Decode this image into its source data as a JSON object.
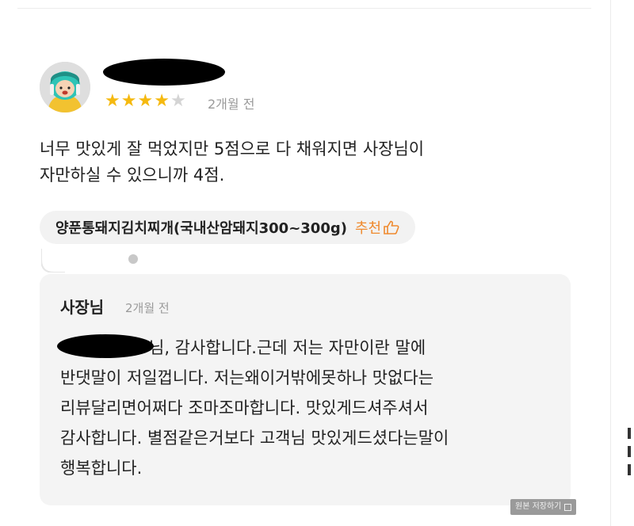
{
  "review": {
    "rating": 4,
    "max_rating": 5,
    "stars": "★★★★★",
    "time": "2개월 전",
    "text_lines": [
      "너무 맛있게 잘 먹었지만 5점으로 다 채워지면 사장님이",
      "자만하실 수 있으니까 4점."
    ],
    "menu_tag": "양푼통돼지김치찌개(국내산암돼지300~300g)",
    "recommend_label": "추천"
  },
  "reply": {
    "author": "사장님",
    "time": "2개월 전",
    "lines": [
      "님, 감사합니다.근데 저는 자만이란 말에",
      "반댓말이 저일껍니다. 저는왜이거밖에못하나  맛없다는",
      "리뷰달리면어쩌다 조마조마합니다.  맛있게드셔주셔서",
      "감사합니다. 별점같은거보다 고객님 맛있게드셨다는말이",
      "행복합니다."
    ]
  },
  "footer": {
    "save_label": "원본 저장하기"
  },
  "colors": {
    "star_filled": "#f5b90f",
    "star_empty": "#d4d4d4",
    "recommend": "#ef8a2e",
    "reply_bg": "#f4f4f4"
  }
}
